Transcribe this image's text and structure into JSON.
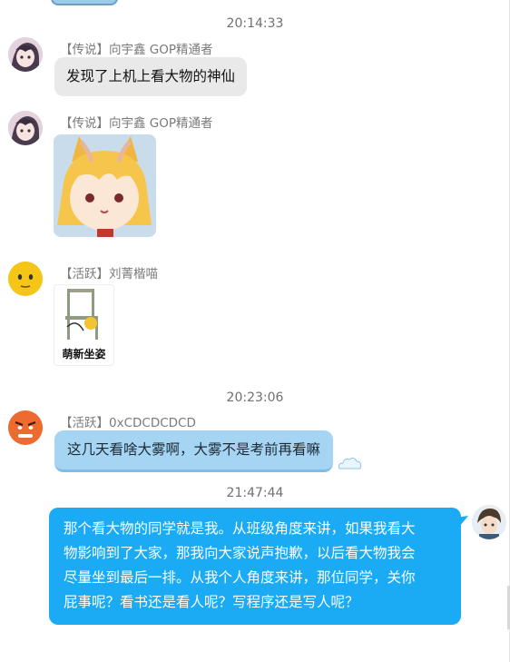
{
  "messages": [
    {
      "type": "timestamp",
      "text": "20:14:33"
    },
    {
      "type": "text",
      "sender": "【传说】向宇鑫 GOP精通者",
      "text": "发现了上机上看大物的神仙"
    },
    {
      "type": "image",
      "sender": "【传说】向宇鑫 GOP精通者"
    },
    {
      "type": "sticker",
      "sender": "【活跃】刘菁楷喵",
      "caption": "萌新坐姿"
    },
    {
      "type": "timestamp",
      "text": "20:23:06"
    },
    {
      "type": "text",
      "sender": "【活跃】0xCDCDCDCD",
      "text": "这几天看啥大雾啊，大雾不是考前再看嘛"
    },
    {
      "type": "timestamp",
      "text": "21:47:44"
    },
    {
      "type": "text",
      "sender": "self",
      "lines": [
        "那个看大物的同学就是我。从班级角度来讲，如果我看大",
        "物影响到了大家，那我向大家说声抱歉，以后看大物我会",
        "尽量坐到最后一排。从我个人角度来讲，那位同学，关你",
        "屁事呢？看书还是看人呢？写程序还是写人呢？"
      ]
    }
  ],
  "colors": {
    "self_bubble": "#1aabf4",
    "other_bubble": "#e9e9e9",
    "accent_bubble": "#a5d5f3"
  },
  "icons": [
    "anime-girl-avatar",
    "anime-fox-girl-image",
    "emoji-face-avatar",
    "chair-sticker",
    "angry-face-avatar",
    "anime-boy-avatar"
  ]
}
